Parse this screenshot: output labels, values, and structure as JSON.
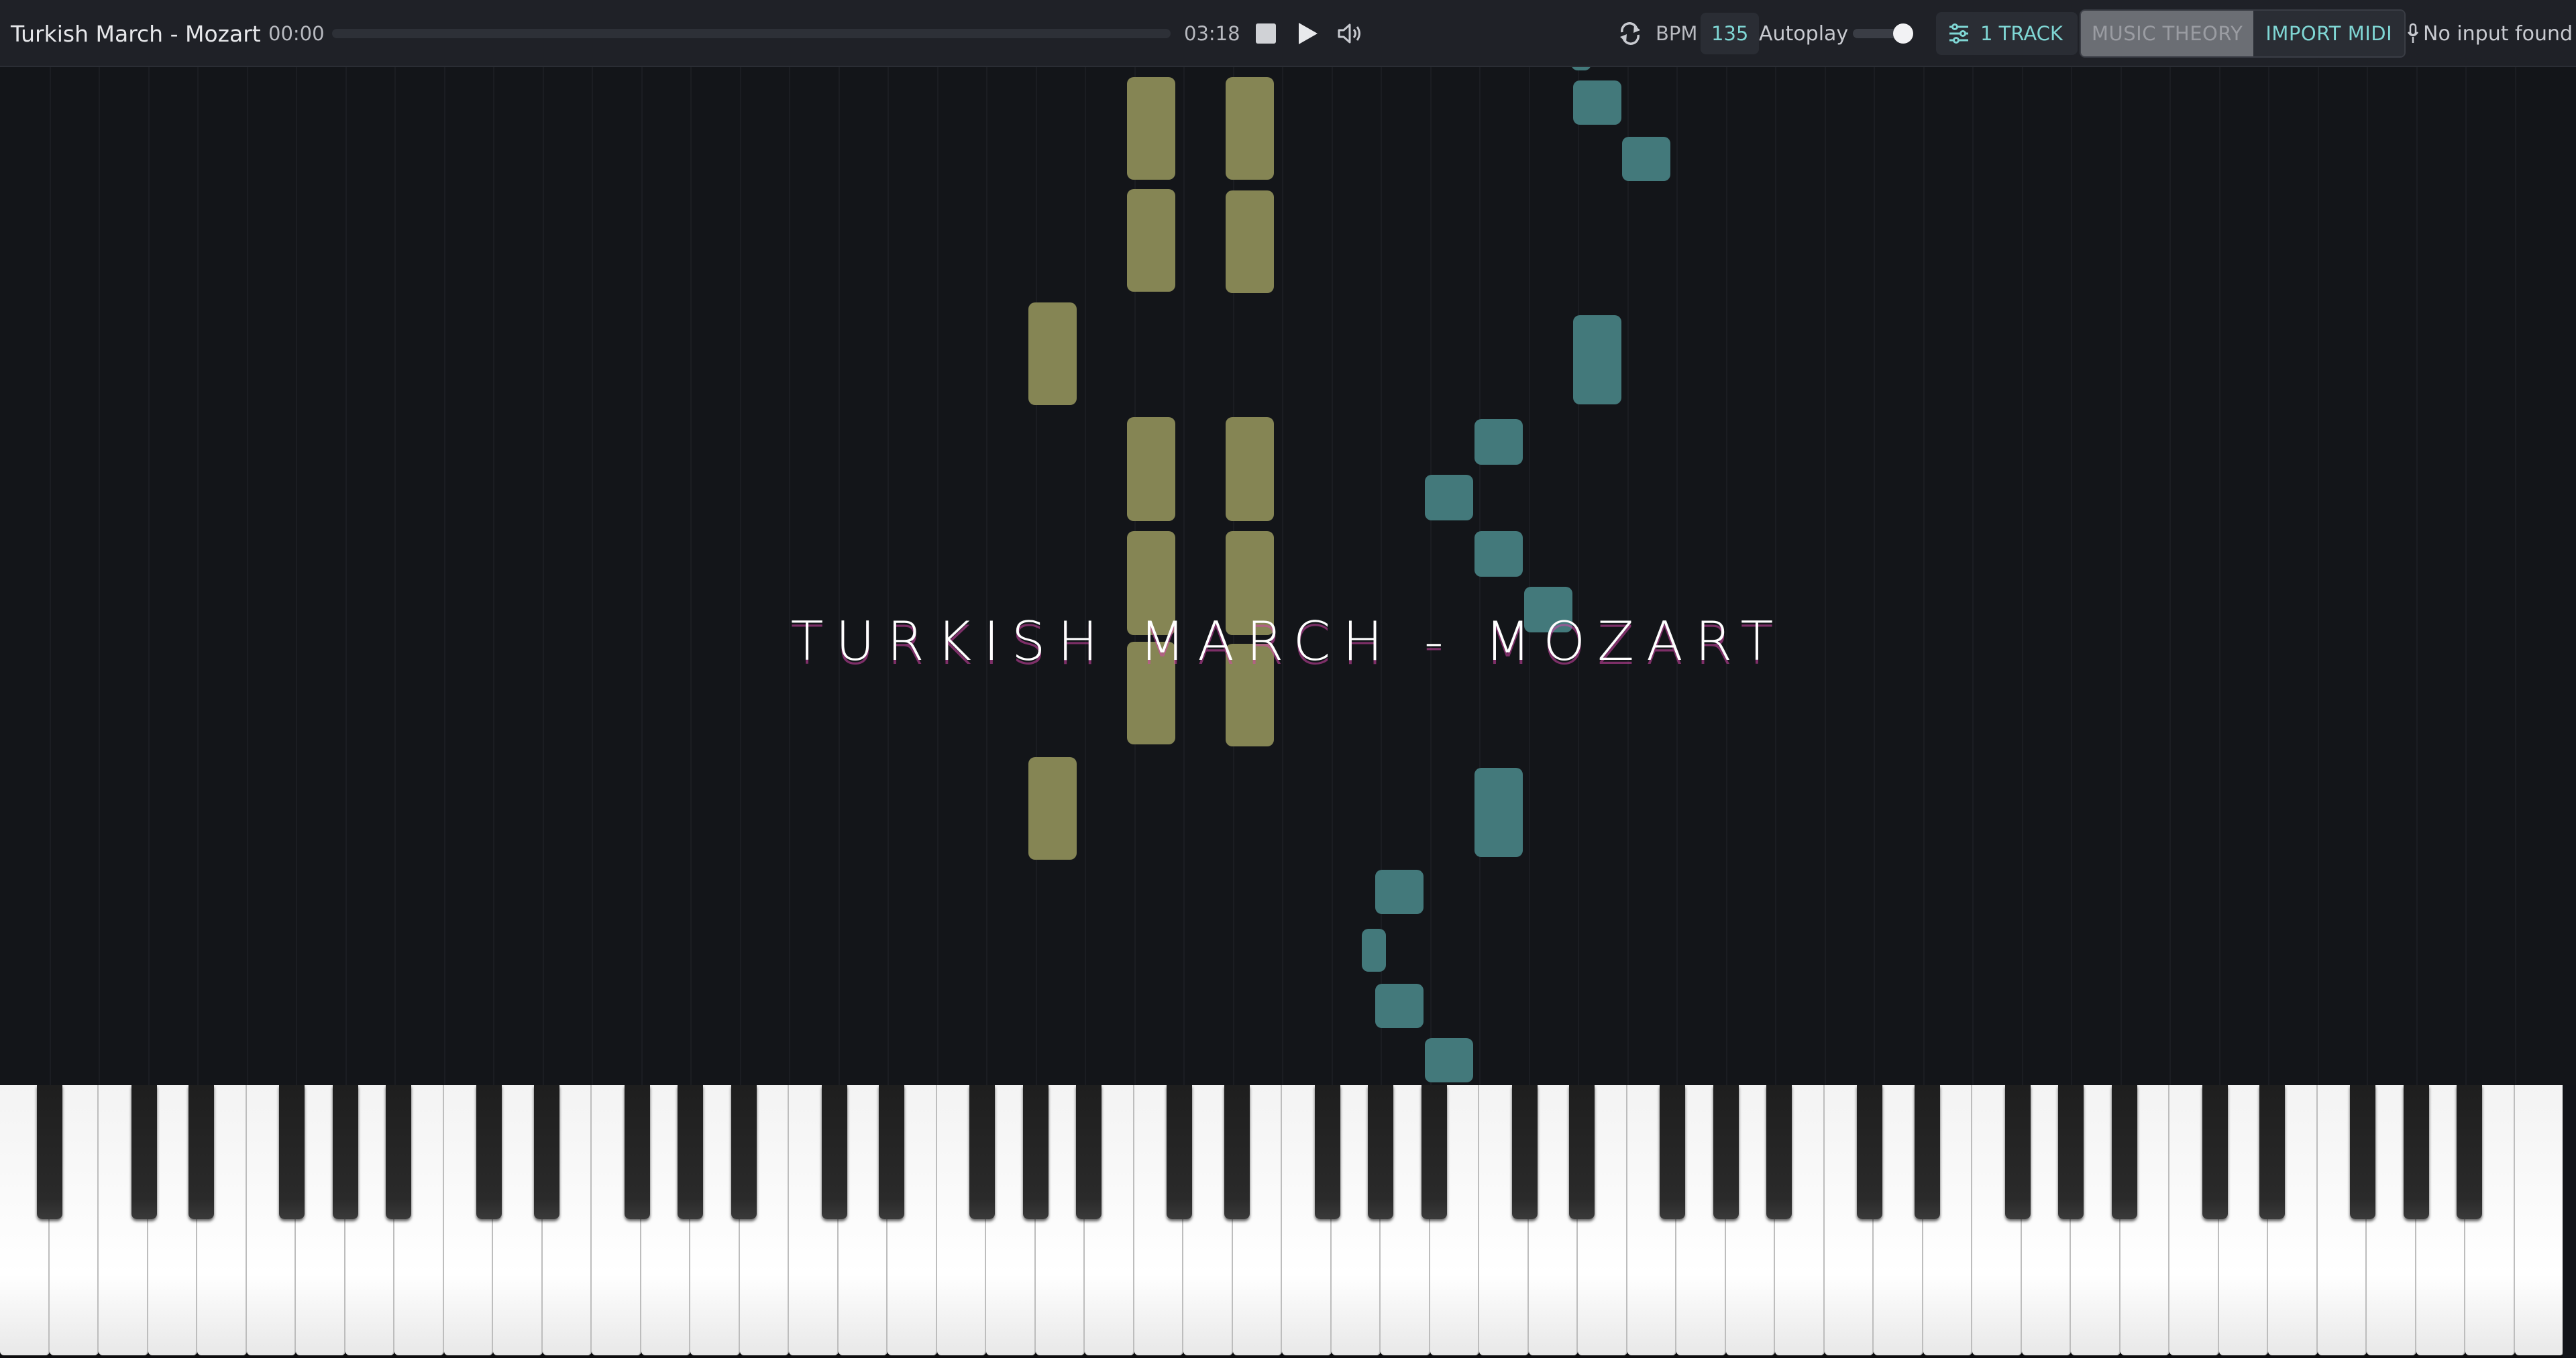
{
  "header": {
    "song_title": "Turkish March - Mozart",
    "time_current": "00:00",
    "time_total": "03:18",
    "progress": 0.0,
    "bpm_label": "BPM",
    "bpm_value": "135",
    "autoplay_label": "Autoplay",
    "autoplay_on": true,
    "tracks_label": "1 TRACK",
    "music_theory_label": "MUSIC THEORY",
    "import_midi_label": "IMPORT MIDI",
    "midi_status": "No input found",
    "icons": {
      "stop": "stop-icon",
      "play": "play-icon",
      "volume": "volume-icon",
      "loop": "loop-icon",
      "tracks": "sliders-icon",
      "midi": "microphone-icon"
    }
  },
  "roll": {
    "overlay_title": "TURKISH MARCH - MOZART",
    "colors": {
      "left_hand": "#858554",
      "right_hand": "#43797b"
    }
  },
  "keyboard": {
    "white_key_count": 52,
    "first_note": "A0",
    "last_note": "C8"
  }
}
